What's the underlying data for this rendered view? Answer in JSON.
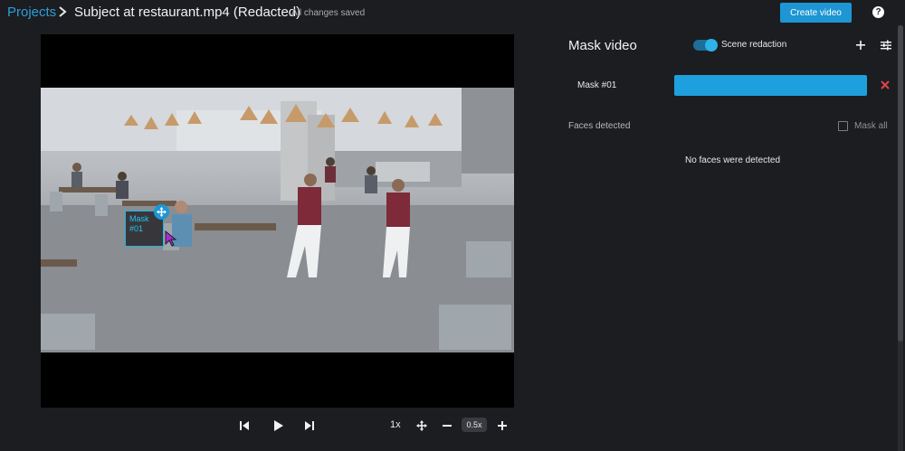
{
  "header": {
    "breadcrumb_root": "Projects",
    "title": "Subject at restaurant.mp4 (Redacted)",
    "save_status": "All changes saved",
    "create_button": "Create video",
    "help_icon": "?"
  },
  "player": {
    "mask_overlay_label": "Mask #01",
    "speed": "1x",
    "zoom": "0.5x",
    "icons": [
      "skip-back-icon",
      "play-icon",
      "skip-forward-icon",
      "move-icon",
      "zoom-out-icon",
      "zoom-in-icon"
    ]
  },
  "panel": {
    "title": "Mask video",
    "scene_redaction_label": "Scene redaction",
    "scene_redaction_on": true,
    "masks": [
      {
        "name": "Mask #01",
        "color": "#1ea0de"
      }
    ],
    "faces_label": "Faces detected",
    "mask_all_label": "Mask all",
    "mask_all_checked": false,
    "empty_message": "No faces were detected"
  },
  "colors": {
    "accent": "#1e96d4",
    "background": "#1c1d21",
    "delete": "#e0434b"
  }
}
